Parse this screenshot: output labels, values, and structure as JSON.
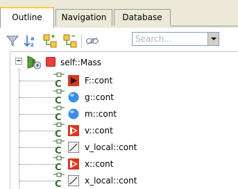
{
  "tabs": [
    {
      "label": "Outline",
      "active": true
    },
    {
      "label": "Navigation",
      "active": false
    },
    {
      "label": "Database",
      "active": false
    }
  ],
  "toolbar": {
    "icons": [
      "filter-icon",
      "sort-icon",
      "expand-icon",
      "collapse-icon",
      "visibility-icon"
    ],
    "search_placeholder": "Search..."
  },
  "tree": {
    "root": {
      "label": "self::Mass",
      "icon": "model-icon",
      "color": "#e8413c"
    },
    "children": [
      {
        "label": "F::cont",
        "type": "input-triangle",
        "color": "#d9381e"
      },
      {
        "label": "g::cont",
        "type": "parameter-circle",
        "color": "#3a8ee6"
      },
      {
        "label": "m::cont",
        "type": "parameter-circle",
        "color": "#3a8ee6"
      },
      {
        "label": "v::cont",
        "type": "state-triangle",
        "color": "#d9381e"
      },
      {
        "label": "v_local::cont",
        "type": "local-curve",
        "color": "#808080"
      },
      {
        "label": "x::cont",
        "type": "state-triangle",
        "color": "#d9381e"
      },
      {
        "label": "x_local::cont",
        "type": "local-curve",
        "color": "#808080"
      }
    ]
  }
}
